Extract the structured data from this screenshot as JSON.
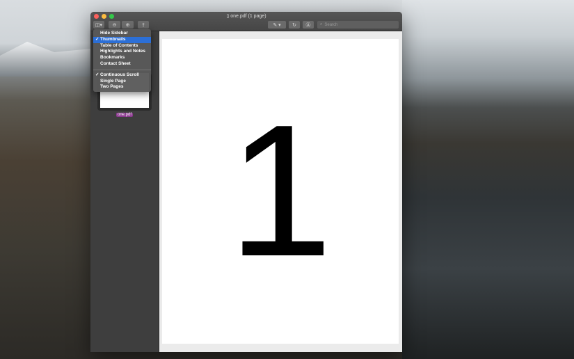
{
  "window": {
    "title": "one.pdf (1 page)"
  },
  "toolbar": {
    "search_placeholder": "Search"
  },
  "sidebar_menu": {
    "items": [
      {
        "label": "Hide Sidebar",
        "checked": false,
        "highlighted": false
      },
      {
        "label": "Thumbnails",
        "checked": true,
        "highlighted": true
      },
      {
        "label": "Table of Contents",
        "checked": false,
        "highlighted": false
      },
      {
        "label": "Highlights and Notes",
        "checked": false,
        "highlighted": false
      },
      {
        "label": "Bookmarks",
        "checked": false,
        "highlighted": false
      },
      {
        "label": "Contact Sheet",
        "checked": false,
        "highlighted": false
      }
    ],
    "view_items": [
      {
        "label": "Continuous Scroll",
        "checked": true
      },
      {
        "label": "Single Page",
        "checked": false
      },
      {
        "label": "Two Pages",
        "checked": false
      }
    ],
    "checkmark": "✓"
  },
  "sidebar": {
    "thumbnail_label": "one.pdf"
  },
  "document": {
    "page_content": "1"
  }
}
